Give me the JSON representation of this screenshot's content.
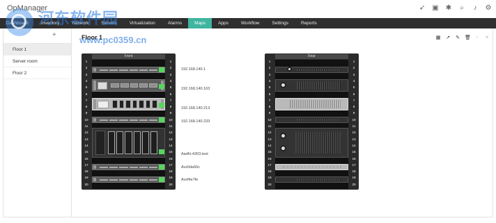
{
  "app": {
    "title": "OpManager"
  },
  "top_icons": [
    "rocket-icon",
    "presentation-icon",
    "bug-icon",
    "search-icon",
    "bell-icon",
    "gear-icon"
  ],
  "nav": {
    "items": [
      {
        "label": "Dashboard",
        "active": false
      },
      {
        "label": "Inventory",
        "active": false
      },
      {
        "label": "Network",
        "active": false
      },
      {
        "label": "Servers",
        "active": false
      },
      {
        "label": "Virtualization",
        "active": false
      },
      {
        "label": "Alarms",
        "active": false
      },
      {
        "label": "Maps",
        "active": true
      },
      {
        "label": "Apps",
        "active": false
      },
      {
        "label": "Workflow",
        "active": false
      },
      {
        "label": "Settings",
        "active": false
      },
      {
        "label": "Reports",
        "active": false
      }
    ]
  },
  "watermark": {
    "line1": "河东软件园",
    "line2": "www.pc0359.cn"
  },
  "sidebar": {
    "add_label": "+",
    "items": [
      {
        "label": "Floor 1",
        "selected": true
      },
      {
        "label": "Server room",
        "selected": false
      },
      {
        "label": "Floor 2",
        "selected": false
      }
    ]
  },
  "main": {
    "title": "Floor 1",
    "tool_icons": [
      "grid-icon",
      "expand-icon",
      "edit-icon",
      "delete-icon",
      "chevron-right-icon",
      "close-icon"
    ]
  },
  "racks": {
    "front": {
      "header": "Front",
      "units": [
        "1",
        "2",
        "3",
        "4",
        "5",
        "6",
        "7",
        "8",
        "9",
        "10",
        "11",
        "12",
        "13",
        "14",
        "15",
        "16",
        "17",
        "18",
        "19",
        "20"
      ],
      "device_labels": [
        "192.168.140.1",
        "192.168.140.163",
        "192.168.140.213",
        "192.168.140.233",
        "Aadhi-4303-test",
        "Avx0da56c",
        "Avxf4e7fe"
      ]
    },
    "rear": {
      "header": "Rear",
      "units": [
        "1",
        "2",
        "3",
        "4",
        "5",
        "6",
        "7",
        "8",
        "9",
        "10",
        "11",
        "12",
        "13",
        "14",
        "15",
        "16",
        "17",
        "18",
        "19",
        "20"
      ]
    }
  },
  "colors": {
    "nav_bg": "#2f2f2f",
    "accent": "#3fb59f",
    "rack_bg": "#2b2b2b",
    "highlight": "#57d65e"
  }
}
